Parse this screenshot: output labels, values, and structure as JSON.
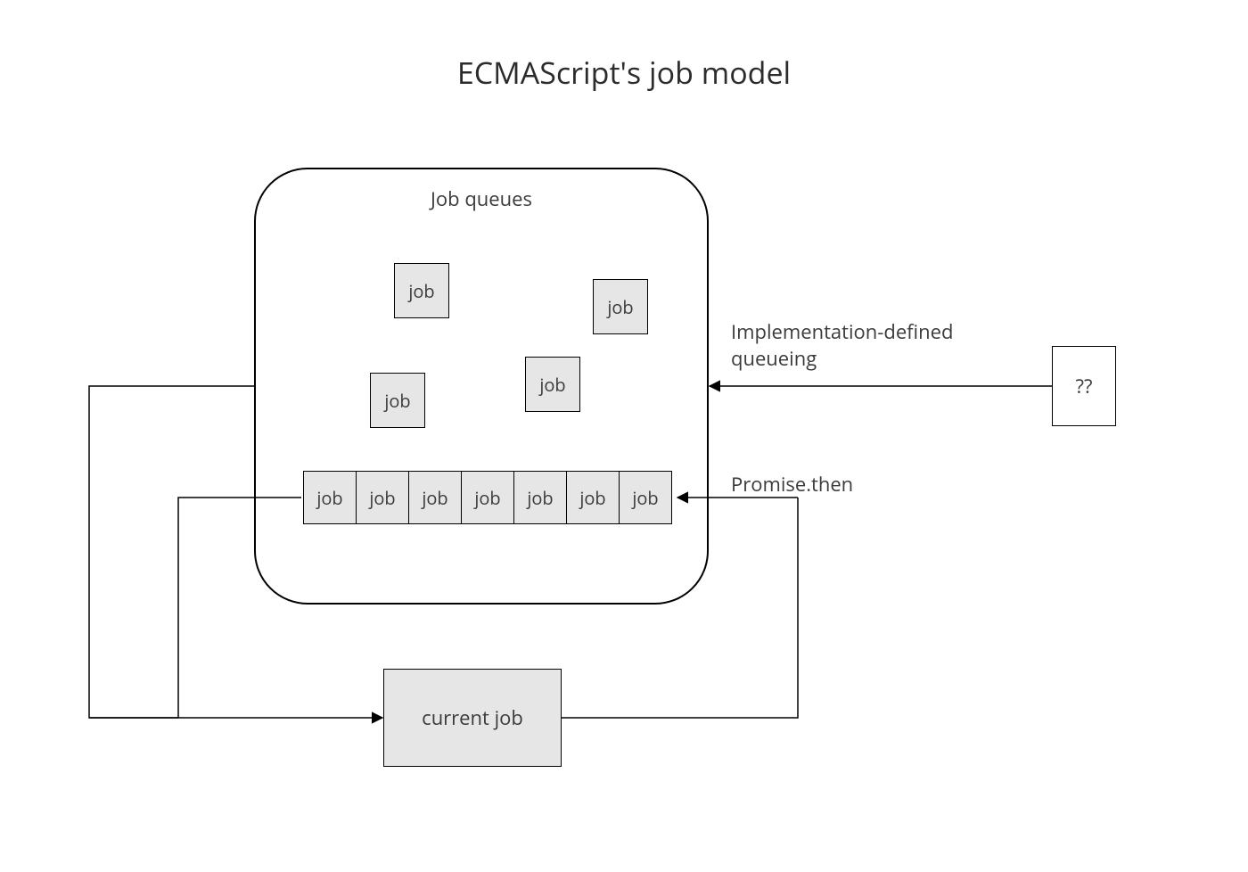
{
  "title": "ECMAScript's job model",
  "queues": {
    "label": "Job queues",
    "floating_jobs": [
      "job",
      "job",
      "job",
      "job"
    ],
    "queue_row": [
      "job",
      "job",
      "job",
      "job",
      "job",
      "job",
      "job"
    ]
  },
  "current_job_label": "current job",
  "unknown_box_label": "??",
  "arrow_labels": {
    "implementation_line1": "Implementation-defined",
    "implementation_line2": "queueing",
    "promise_then": "Promise.then"
  }
}
